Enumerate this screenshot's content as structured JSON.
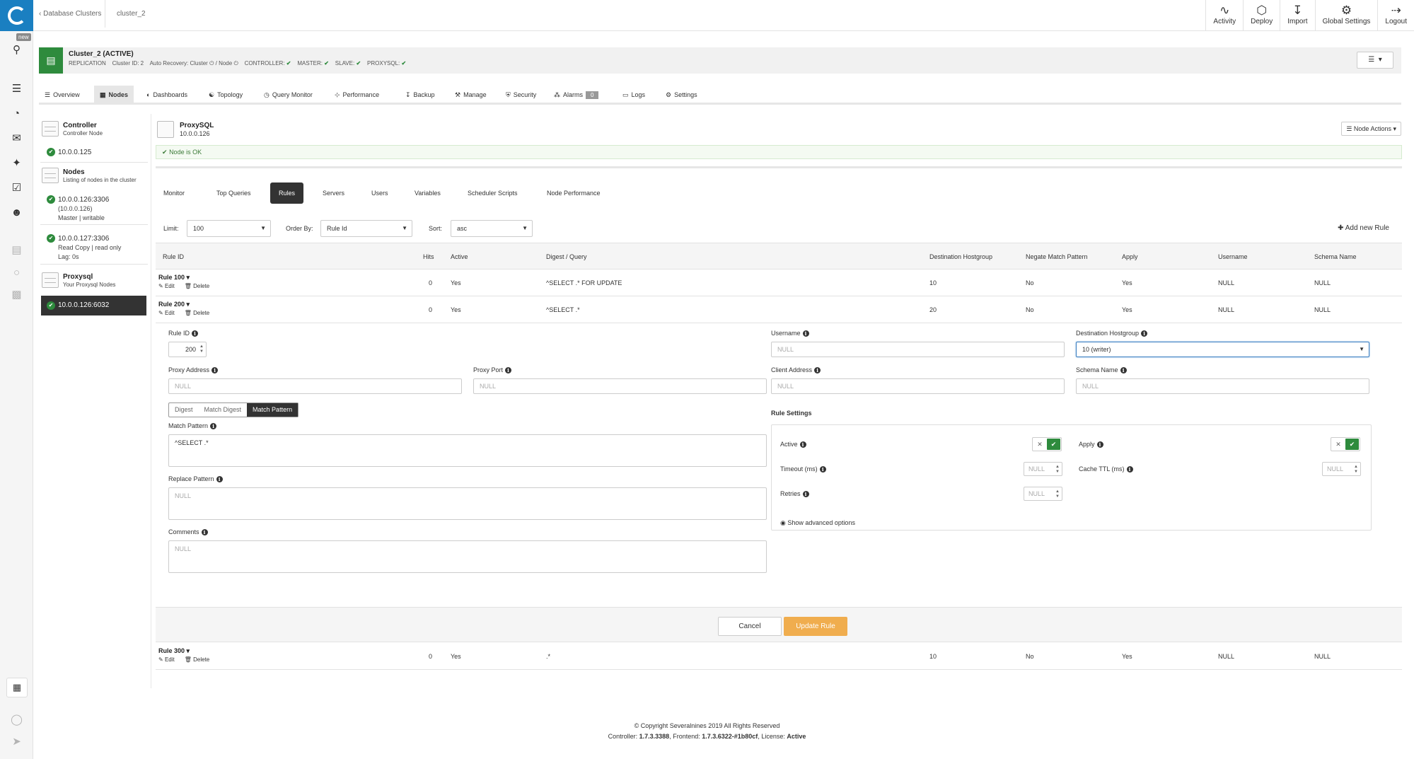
{
  "breadcrumb": {
    "back_label": "Database Clusters",
    "current": "cluster_2"
  },
  "top_actions": [
    {
      "label": "Activity",
      "icon": "activity-icon"
    },
    {
      "label": "Deploy",
      "icon": "deploy-icon"
    },
    {
      "label": "Import",
      "icon": "import-icon"
    },
    {
      "label": "Global Settings",
      "icon": "global-settings-icon"
    },
    {
      "label": "Logout",
      "icon": "logout-icon"
    }
  ],
  "rail": {
    "new_badge": "new"
  },
  "cluster": {
    "title": "Cluster_2 (ACTIVE)",
    "type": "REPLICATION",
    "cluster_id": "Cluster ID: 2",
    "auto_recovery_label": "Auto Recovery: Cluster",
    "node_label": "/ Node",
    "controller": "CONTROLLER:",
    "master": "MASTER:",
    "slave": "SLAVE:",
    "proxysql": "PROXYSQL:"
  },
  "nav_tabs": {
    "overview": "Overview",
    "nodes": "Nodes",
    "dashboards": "Dashboards",
    "topology": "Topology",
    "query_monitor": "Query Monitor",
    "performance": "Performance",
    "backup": "Backup",
    "manage": "Manage",
    "security": "Security",
    "alarms": "Alarms",
    "alarms_count": "0",
    "logs": "Logs",
    "settings": "Settings"
  },
  "sidebar": {
    "controller": {
      "title": "Controller",
      "subtitle": "Controller Node",
      "ip": "10.0.0.125"
    },
    "nodes_group": {
      "title": "Nodes",
      "subtitle": "Listing of nodes in the cluster"
    },
    "node1": {
      "ip": "10.0.0.126:3306",
      "ip2": "(10.0.0.126)",
      "role": "Master | writable"
    },
    "node2": {
      "ip": "10.0.0.127:3306",
      "role": "Read Copy | read only",
      "lag": "Lag: 0s"
    },
    "proxysql_group": {
      "title": "Proxysql",
      "subtitle": "Your Proxysql Nodes"
    },
    "proxysql_node": "10.0.0.126:6032"
  },
  "proxysql": {
    "title": "ProxySQL",
    "ip": "10.0.0.126",
    "node_actions": "Node Actions",
    "status": "Node is OK"
  },
  "sub_tabs": {
    "monitor": "Monitor",
    "top_queries": "Top Queries",
    "rules": "Rules",
    "servers": "Servers",
    "users": "Users",
    "variables": "Variables",
    "scheduler": "Scheduler Scripts",
    "node_perf": "Node Performance"
  },
  "filters": {
    "limit_label": "Limit:",
    "limit_value": "100",
    "order_label": "Order By:",
    "order_value": "Rule Id",
    "sort_label": "Sort:",
    "sort_value": "asc",
    "add_rule": "Add new Rule"
  },
  "table": {
    "headers": {
      "rule_id": "Rule ID",
      "hits": "Hits",
      "active": "Active",
      "digest": "Digest / Query",
      "dest": "Destination Hostgroup",
      "negate": "Negate Match Pattern",
      "apply": "Apply",
      "username": "Username",
      "schema": "Schema Name"
    },
    "edit": "Edit",
    "delete": "Delete",
    "rows": [
      {
        "name": "Rule 100",
        "hits": "0",
        "active": "Yes",
        "digest": "^SELECT .* FOR UPDATE",
        "dest": "10",
        "negate": "No",
        "apply": "Yes",
        "username": "NULL",
        "schema": "NULL"
      },
      {
        "name": "Rule 200",
        "hits": "0",
        "active": "Yes",
        "digest": "^SELECT .*",
        "dest": "20",
        "negate": "No",
        "apply": "Yes",
        "username": "NULL",
        "schema": "NULL"
      },
      {
        "name": "Rule 300",
        "hits": "0",
        "active": "Yes",
        "digest": ".*",
        "dest": "10",
        "negate": "No",
        "apply": "Yes",
        "username": "NULL",
        "schema": "NULL"
      }
    ]
  },
  "form": {
    "rule_id_label": "Rule ID",
    "rule_id_value": "200",
    "proxy_address_label": "Proxy Address",
    "proxy_address_ph": "NULL",
    "proxy_port_label": "Proxy Port",
    "proxy_port_ph": "NULL",
    "username_label": "Username",
    "username_ph": "NULL",
    "dest_label": "Destination Hostgroup",
    "dest_value": "10 (writer)",
    "client_address_label": "Client Address",
    "client_address_ph": "NULL",
    "schema_label": "Schema Name",
    "schema_ph": "NULL",
    "seg": {
      "digest": "Digest",
      "match_digest": "Match Digest",
      "match_pattern": "Match Pattern"
    },
    "match_pattern_label": "Match Pattern",
    "match_pattern_value": "^SELECT .*",
    "replace_pattern_label": "Replace Pattern",
    "replace_pattern_ph": "NULL",
    "comments_label": "Comments",
    "comments_ph": "NULL",
    "rule_settings_title": "Rule Settings",
    "active_label": "Active",
    "apply_label": "Apply",
    "timeout_label": "Timeout (ms)",
    "timeout_ph": "NULL",
    "cache_ttl_label": "Cache TTL (ms)",
    "cache_ttl_ph": "NULL",
    "retries_label": "Retries",
    "retries_ph": "NULL",
    "show_advanced": "Show advanced options",
    "cancel": "Cancel",
    "update": "Update Rule"
  },
  "footer": {
    "copyright": "© Copyright Severalnines 2019 All Rights Reserved",
    "controller_label": "Controller:",
    "controller_version": "1.7.3.3388",
    "frontend_label": "Frontend:",
    "frontend_version": "1.7.3.6322-#1b80cf",
    "license_label": "License:",
    "license_value": "Active"
  }
}
